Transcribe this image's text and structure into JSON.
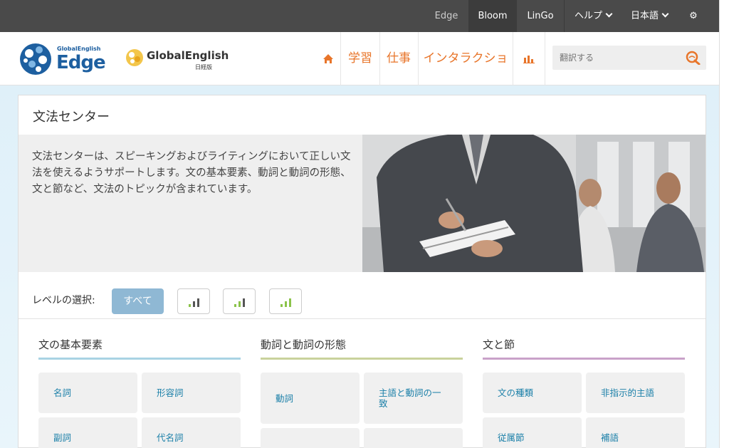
{
  "topbar": {
    "edge": "Edge",
    "bloom": "Bloom",
    "lingo": "LinGo",
    "help": "ヘルプ",
    "language": "日本語",
    "settings_icon": "gear-icon"
  },
  "header": {
    "logo_edge_small": "GlobalEnglish",
    "logo_edge_big": "Edge",
    "logo_ge": "GlobalEnglish",
    "logo_ge_sub": "日経版",
    "nav": {
      "home_icon": "home-icon",
      "study": "学習",
      "work": "仕事",
      "interaction": "インタラクション",
      "stats_icon": "bar-chart-icon"
    },
    "search_placeholder": "翻訳する"
  },
  "panel": {
    "title": "文法センター",
    "description": "文法センターは、スピーキングおよびライティングにおいて正しい文法を使えるようサポートします。文の基本要素、動詞と動詞の形態、文と節など、文法のトピックが含まれています。",
    "level_label": "レベルの選択:",
    "level_all": "すべて"
  },
  "columns": [
    {
      "title": "文の基本要素",
      "color": "#a9d3e4",
      "tiles": [
        "名詞",
        "形容詞",
        "副詞",
        "代名詞"
      ]
    },
    {
      "title": "動詞と動詞の形態",
      "color": "#c9d29c",
      "tiles": [
        "動詞",
        "主語と動詞の一致",
        "",
        ""
      ]
    },
    {
      "title": "文と節",
      "color": "#c9a2c9",
      "tiles": [
        "文の種類",
        "非指示的主語",
        "従属節",
        "補語"
      ]
    }
  ],
  "colors": {
    "accent": "#e8752a",
    "link": "#1a7fa8",
    "topbar": "#4a4a4a"
  }
}
